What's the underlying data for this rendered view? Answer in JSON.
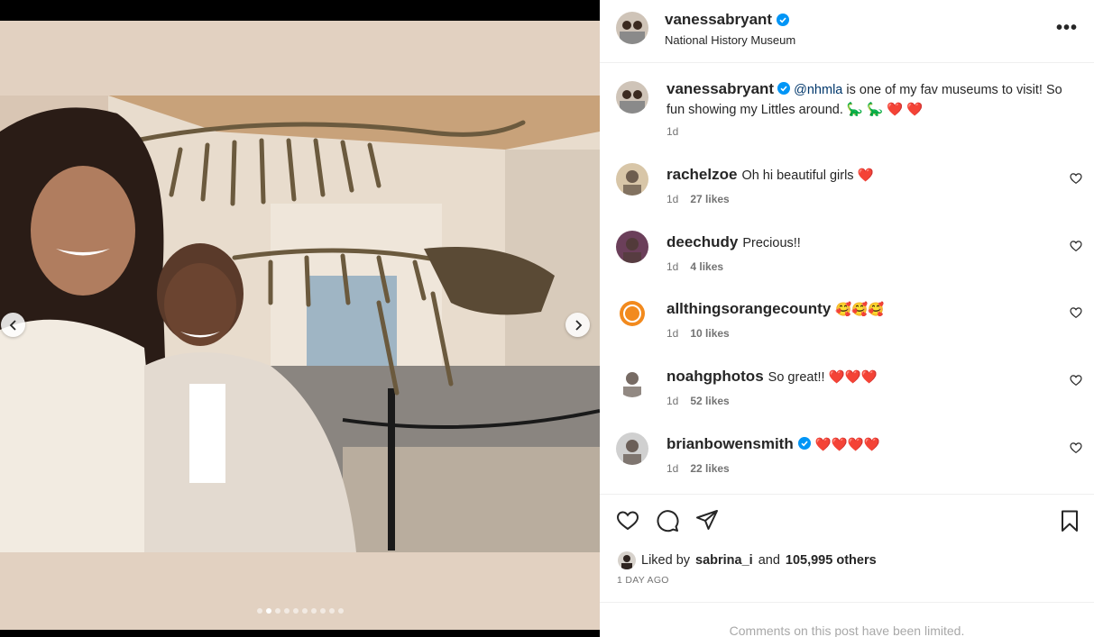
{
  "post": {
    "author": "vanessabryant",
    "location": "National History Museum",
    "more_label": "•••",
    "carousel": {
      "total_slides": 10,
      "active_slide": 2
    }
  },
  "caption": {
    "author": "vanessabryant",
    "mention": "@nhmla",
    "text": " is one of my fav museums to visit! So fun showing my Littles around. 🦕 🦕 ❤️ ❤️",
    "time": "1d"
  },
  "comments": [
    {
      "user": "rachelzoe",
      "text": "Oh hi beautiful girls ❤️",
      "time": "1d",
      "likes": "27 likes",
      "verified": false
    },
    {
      "user": "deechudy",
      "text": "Precious!!",
      "time": "1d",
      "likes": "4 likes",
      "verified": false
    },
    {
      "user": "allthingsorangecounty",
      "text": "🥰🥰🥰",
      "time": "1d",
      "likes": "10 likes",
      "verified": false
    },
    {
      "user": "noahgphotos",
      "text": "So great!! ❤️❤️❤️",
      "time": "1d",
      "likes": "52 likes",
      "verified": false
    },
    {
      "user": "brianbowensmith",
      "text": "❤️❤️❤️❤️",
      "time": "1d",
      "likes": "22 likes",
      "verified": true
    }
  ],
  "likes_summary": {
    "prefix": "Liked by",
    "user": "sabrina_i",
    "connector": "and",
    "others": "105,995 others"
  },
  "date": "1 DAY AGO",
  "comments_limited": "Comments on this post have been limited.",
  "icons": {
    "like": "heart-outline-icon",
    "comment": "speech-bubble-icon",
    "share": "paper-plane-icon",
    "save": "bookmark-icon",
    "verified": "verified-badge-icon"
  },
  "colors": {
    "verified": "#0095f6",
    "heart": "#ed1c24",
    "muted": "#737373"
  }
}
